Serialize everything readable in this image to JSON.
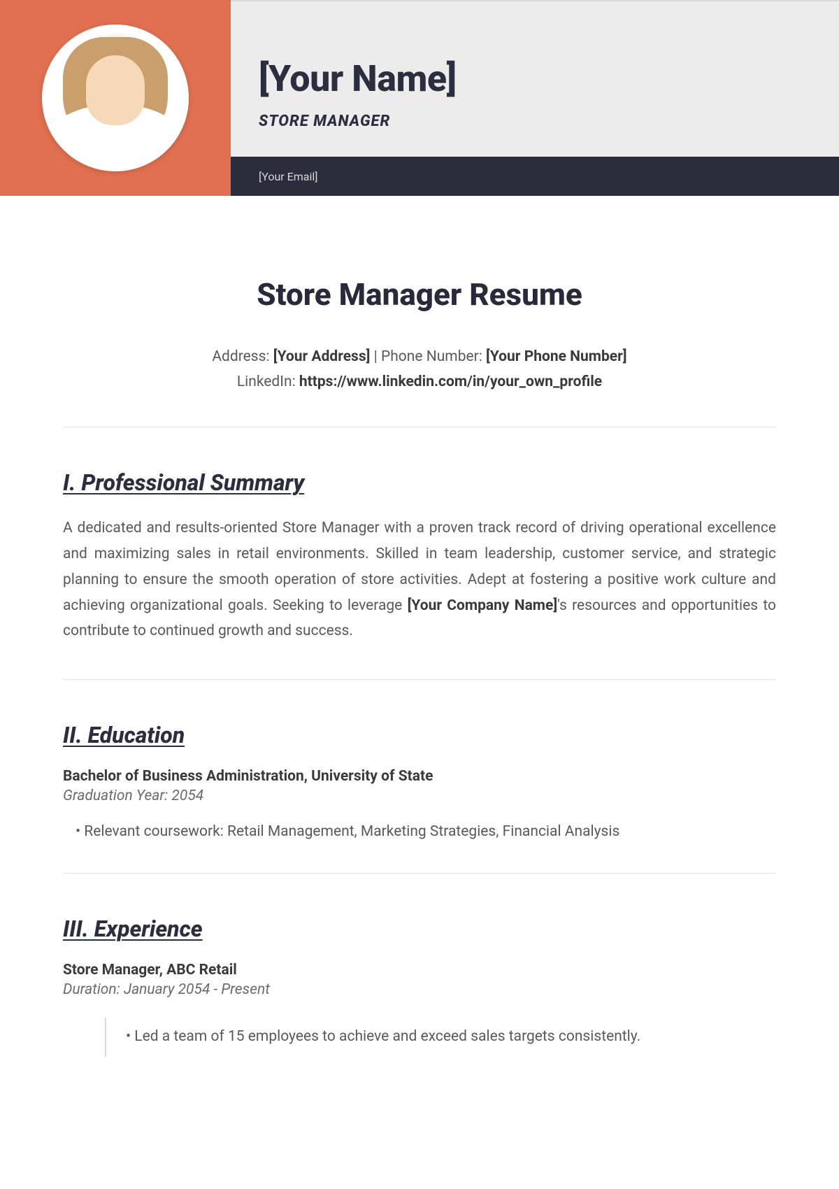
{
  "header": {
    "name": "[Your Name]",
    "role": "STORE MANAGER",
    "email": "[Your Email]"
  },
  "doc_title": "Store Manager Resume",
  "contact": {
    "address_label": "Address: ",
    "address": "[Your Address]",
    "separator": " | ",
    "phone_label": "Phone Number: ",
    "phone": "[Your Phone Number]",
    "linkedin_label": "LinkedIn: ",
    "linkedin": "https://www.linkedin.com/in/your_own_profile"
  },
  "sections": {
    "summary": {
      "heading": "I. Professional Summary",
      "text_pre": "A dedicated and results-oriented Store Manager with a proven track record of driving operational excellence and maximizing sales in retail environments. Skilled in team leadership, customer service, and strategic planning to ensure the smooth operation of store activities. Adept at fostering a positive work culture and achieving organizational goals. Seeking to leverage ",
      "company_placeholder": "[Your Company Name]",
      "text_post": "'s resources and opportunities to contribute to continued growth and success."
    },
    "education": {
      "heading": "II. Education",
      "degree": "Bachelor of Business Administration, University of State",
      "grad_year": "Graduation Year: 2054",
      "coursework": "• Relevant coursework: Retail Management, Marketing Strategies, Financial Analysis"
    },
    "experience": {
      "heading": "III. Experience",
      "job_title": "Store Manager, ABC Retail",
      "duration": "Duration: January 2054 - Present",
      "bullets": [
        "• Led a team of 15 employees to achieve and exceed sales targets consistently."
      ]
    }
  }
}
